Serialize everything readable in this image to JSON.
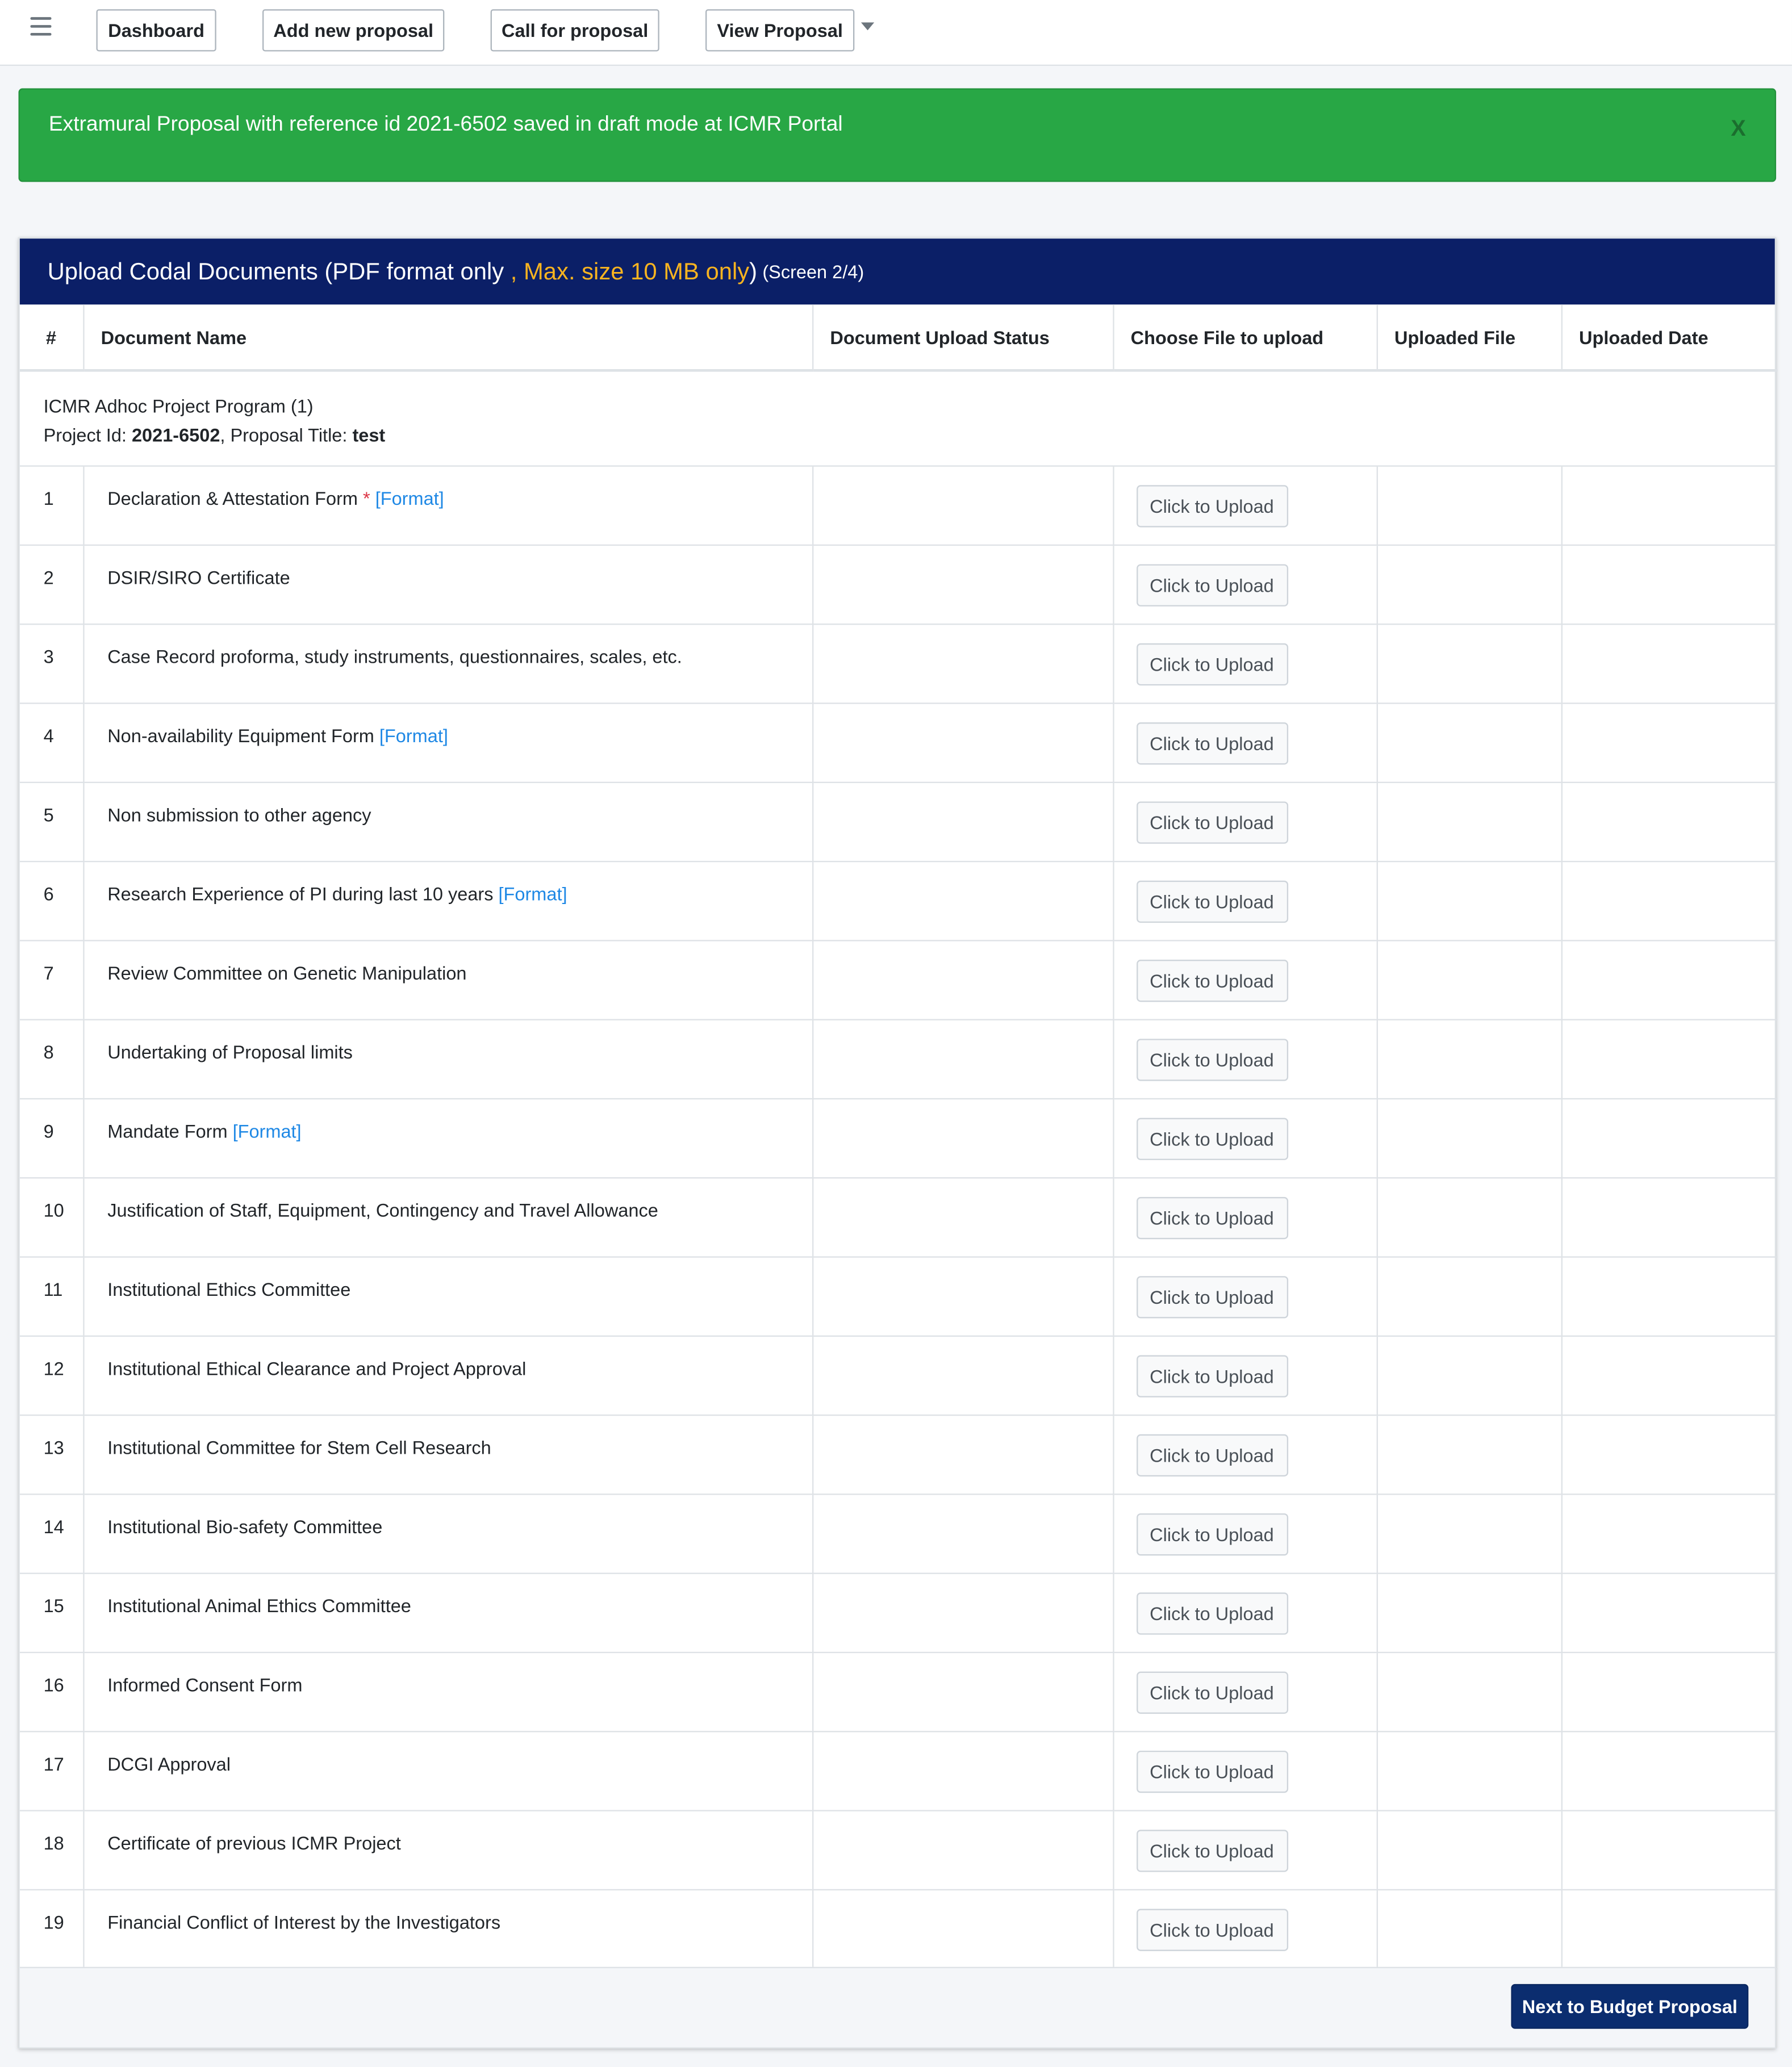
{
  "nav": {
    "dashboard": "Dashboard",
    "add_new_proposal": "Add new proposal",
    "call_for_proposal": "Call for proposal",
    "view_proposal": "View Proposal"
  },
  "alert": {
    "message": "Extramural Proposal with reference id 2021-6502 saved in draft mode at ICMR Portal",
    "close": "X"
  },
  "card": {
    "title_main": "Upload Codal Documents (PDF format only",
    "title_sep": " , ",
    "title_warn": "Max. size 10 MB only",
    "title_close": ")",
    "title_screen": "(Screen 2/4)"
  },
  "table": {
    "headers": [
      "#",
      "Document Name",
      "Document Upload Status",
      "Choose File to upload",
      "Uploaded File",
      "Uploaded Date"
    ],
    "program": "ICMR Adhoc Project Program (1)",
    "project_id_label": "Project Id: ",
    "project_id": "2021-6502",
    "proposal_title_label": ", Proposal Title: ",
    "proposal_title": "test",
    "upload_label": "Click to Upload",
    "required_marker": "*",
    "format_link": "[Format]",
    "rows": [
      {
        "num": "1",
        "name": "Declaration & Attestation Form",
        "required": true,
        "format": true
      },
      {
        "num": "2",
        "name": "DSIR/SIRO Certificate",
        "required": false,
        "format": false
      },
      {
        "num": "3",
        "name": "Case Record proforma, study instruments, questionnaires, scales, etc.",
        "required": false,
        "format": false
      },
      {
        "num": "4",
        "name": "Non-availability Equipment Form",
        "required": false,
        "format": true
      },
      {
        "num": "5",
        "name": "Non submission to other agency",
        "required": false,
        "format": false
      },
      {
        "num": "6",
        "name": "Research Experience of PI during last 10 years",
        "required": false,
        "format": true
      },
      {
        "num": "7",
        "name": "Review Committee on Genetic Manipulation",
        "required": false,
        "format": false
      },
      {
        "num": "8",
        "name": "Undertaking of Proposal limits",
        "required": false,
        "format": false
      },
      {
        "num": "9",
        "name": "Mandate Form",
        "required": false,
        "format": true
      },
      {
        "num": "10",
        "name": "Justification of Staff, Equipment, Contingency and Travel Allowance",
        "required": false,
        "format": false
      },
      {
        "num": "11",
        "name": "Institutional Ethics Committee",
        "required": false,
        "format": false
      },
      {
        "num": "12",
        "name": "Institutional Ethical Clearance and Project Approval",
        "required": false,
        "format": false
      },
      {
        "num": "13",
        "name": "Institutional Committee for Stem Cell Research",
        "required": false,
        "format": false
      },
      {
        "num": "14",
        "name": "Institutional Bio-safety Committee",
        "required": false,
        "format": false
      },
      {
        "num": "15",
        "name": "Institutional Animal Ethics Committee",
        "required": false,
        "format": false
      },
      {
        "num": "16",
        "name": "Informed Consent Form",
        "required": false,
        "format": false
      },
      {
        "num": "17",
        "name": "DCGI Approval",
        "required": false,
        "format": false
      },
      {
        "num": "18",
        "name": "Certificate of previous ICMR Project",
        "required": false,
        "format": false
      },
      {
        "num": "19",
        "name": "Financial Conflict of Interest by the Investigators",
        "required": false,
        "format": false
      }
    ]
  },
  "footer": {
    "next_button": "Next to Budget Proposal"
  },
  "colors": {
    "alert_bg": "#28a745",
    "header_bg": "#0b1f67",
    "header_warn": "#f9b420",
    "link": "#1e88e5",
    "required": "#dc3545",
    "next_button_bg": "#0b2d6f"
  }
}
